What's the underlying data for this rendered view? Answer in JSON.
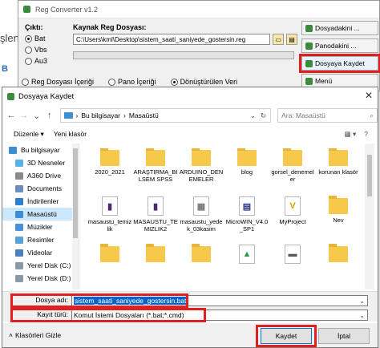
{
  "background": {
    "left_fragment_1": "şlen",
    "left_fragment_2": "B",
    "app_title": "Reg Converter v1.2",
    "output_label": "Çıktı:",
    "output_options": [
      {
        "label": "Bat",
        "selected": true
      },
      {
        "label": "Vbs",
        "selected": false
      },
      {
        "label": "Au3",
        "selected": false
      }
    ],
    "source_label": "Kaynak Reg Dosyası:",
    "source_path": "C:\\Users\\kml\\Desktop\\sistem_saati_saniyede_gostersin.reg",
    "options": [
      {
        "label": "Reg Dosyası İçeriği",
        "selected": false
      },
      {
        "label": "Pano İçeriği",
        "selected": false
      },
      {
        "label": "Dönüştürülen Veri",
        "selected": true
      }
    ],
    "side_buttons": [
      "Dosyadakini ...",
      "Panodakini ...",
      "Dosyaya Kaydet",
      "Menü"
    ]
  },
  "dialog": {
    "title": "Dosyaya Kaydet",
    "close_glyph": "✕",
    "breadcrumb": [
      "Bu bilgisayar",
      "Masaüstü"
    ],
    "search_placeholder": "Ara: Masaüstü",
    "toolbar": {
      "organize": "Düzenle ▾",
      "new_folder": "Yeni klasör"
    },
    "nav_items": [
      {
        "label": "Bu bilgisayar",
        "color": "#3e8ed6",
        "selected": false
      },
      {
        "label": "3D Nesneler",
        "color": "#5ab0e8",
        "selected": false
      },
      {
        "label": "A360 Drive",
        "color": "#8a8a8a",
        "selected": false
      },
      {
        "label": "Documents",
        "color": "#6b8fb8",
        "selected": false
      },
      {
        "label": "İndirilenler",
        "color": "#2f7fd0",
        "selected": false
      },
      {
        "label": "Masaüstü",
        "color": "#3e8ed6",
        "selected": true
      },
      {
        "label": "Müzikler",
        "color": "#4a90d9",
        "selected": false
      },
      {
        "label": "Resimler",
        "color": "#5aa0d8",
        "selected": false
      },
      {
        "label": "Videolar",
        "color": "#4c7ec0",
        "selected": false
      },
      {
        "label": "Yerel Disk (C:)",
        "color": "#8c9aa8",
        "selected": false
      },
      {
        "label": "Yerel Disk (D:)",
        "color": "#8c9aa8",
        "selected": false
      }
    ],
    "files": [
      {
        "name": "2020_2021",
        "kind": "folder"
      },
      {
        "name": "ARAŞTIRMA_BİLSEM SPSS",
        "kind": "folder"
      },
      {
        "name": "ARDUINO_DENEMELER",
        "kind": "folder"
      },
      {
        "name": "blog",
        "kind": "folder"
      },
      {
        "name": "gorsel_denemeler",
        "kind": "folder"
      },
      {
        "name": "korunan klasör",
        "kind": "folder"
      },
      {
        "name": "masaustu_temizlik",
        "kind": "doc",
        "glyph": "▮",
        "color": "#4a2a6a"
      },
      {
        "name": "MASAUSTU_TEMIZLIK2",
        "kind": "doc",
        "glyph": "▮",
        "color": "#4a2a6a"
      },
      {
        "name": "masaustu_yedek_03kasim",
        "kind": "doc",
        "glyph": "▦",
        "color": "#777777"
      },
      {
        "name": "MicroWIN_V4.0_SP1",
        "kind": "doc",
        "glyph": "▤",
        "color": "#2a3a8a"
      },
      {
        "name": "MyProject",
        "kind": "doc",
        "glyph": "V",
        "color": "#c9a400"
      },
      {
        "name": "Nev",
        "kind": "folder"
      },
      {
        "name": "",
        "kind": "folder"
      },
      {
        "name": "",
        "kind": "folder"
      },
      {
        "name": "",
        "kind": "folder"
      },
      {
        "name": "",
        "kind": "doc",
        "glyph": "▲",
        "color": "#2a9a4a"
      },
      {
        "name": "",
        "kind": "doc",
        "glyph": "▬",
        "color": "#555555"
      },
      {
        "name": "",
        "kind": "folder"
      }
    ],
    "filename_label": "Dosya adı:",
    "filename_value": "sistem_saati_saniyede_gostersin.bat",
    "filetype_label": "Kayıt türü:",
    "filetype_value": "Komut İstemi Dosyaları (*.bat;*.cmd)",
    "hide_folders_label": "Klasörleri Gizle",
    "save_label": "Kaydet",
    "cancel_label": "İptal",
    "highlight_color": "#e02020"
  }
}
